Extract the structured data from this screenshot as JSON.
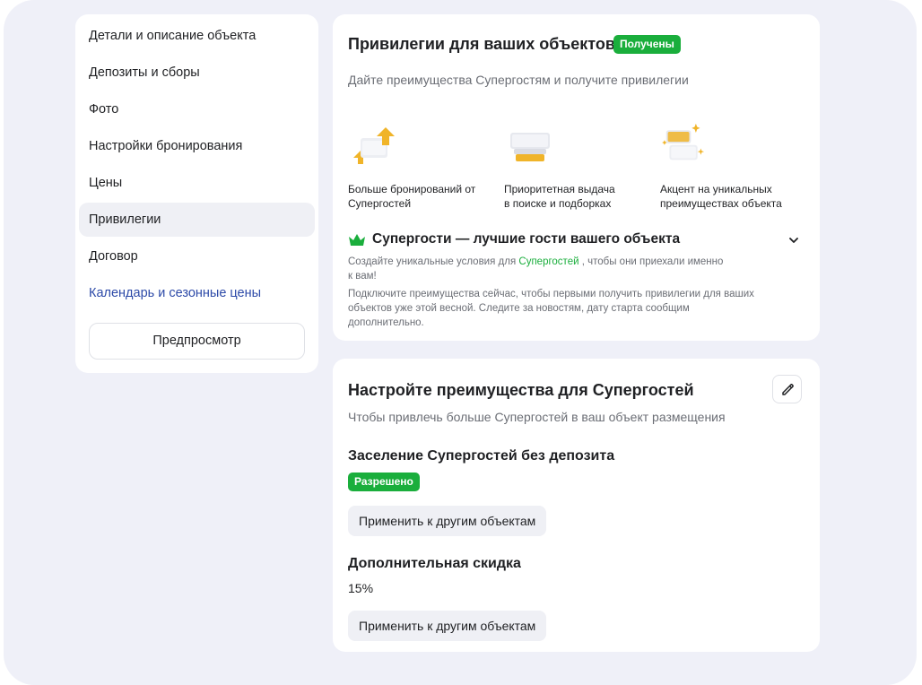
{
  "sidebar": {
    "items": [
      {
        "label": "Детали и описание объекта"
      },
      {
        "label": "Депозиты и сборы"
      },
      {
        "label": "Фото"
      },
      {
        "label": "Настройки бронирования"
      },
      {
        "label": "Цены"
      },
      {
        "label": "Привилегии"
      },
      {
        "label": "Договор"
      },
      {
        "label": "Календарь и сезонные цены"
      }
    ],
    "active": "Привилегии",
    "preview_label": "Предпросмотр"
  },
  "privileges": {
    "title": "Привилегии для ваших объектов",
    "badge": "Получены",
    "subtitle": "Дайте преимущества Супергостям и получите привилегии",
    "features": [
      {
        "icon": "arrows-up-icon",
        "line1": "Больше бронирований от",
        "line2": "Супергостей"
      },
      {
        "icon": "stacked-cards-icon",
        "line1": "Приоритетная выдача",
        "line2": "в поиске и подборках"
      },
      {
        "icon": "sparkle-cards-icon",
        "line1": "Акцент на уникальных",
        "line2": "преимуществах объекта"
      }
    ],
    "superguests": {
      "title": "Супергости — лучшие гости вашего объекта",
      "text1_before": "Создайте уникальные условия для",
      "text1_link": "Супергостей",
      "text1_after": ", чтобы они приехали именно",
      "text1_line2": "к вам!",
      "text2_line1": "Подключите преимущества сейчас, чтобы первыми получить привилегии для ваших",
      "text2_line2": "объектов уже этой весной. Следите за новостям, дату старта сообщим",
      "text2_line3": "дополнительно."
    }
  },
  "setup": {
    "title": "Настройте преимущества для Супергостей",
    "subtitle": "Чтобы привлечь больше Супергостей в ваш объект размещения",
    "deposit": {
      "title": "Заселение Супергостей без депозита",
      "status": "Разрешено",
      "apply_label": "Применить к другим объектам"
    },
    "discount": {
      "title": "Дополнительная скидка",
      "value": "15%",
      "apply_label": "Применить к другим объектам"
    }
  },
  "colors": {
    "accent_green": "#1aae3c",
    "link_blue": "#2d4aa8",
    "icon_gold": "#f0b429",
    "background": "#eff0f8"
  }
}
